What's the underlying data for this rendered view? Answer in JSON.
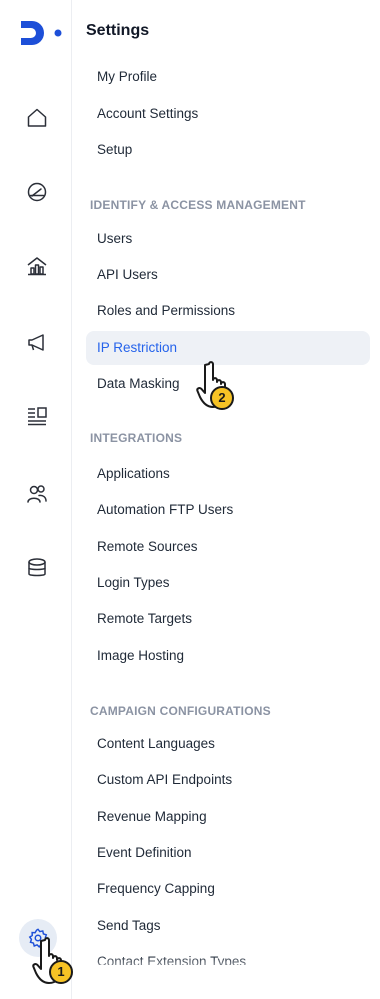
{
  "menu_title": "Settings",
  "top_items": [
    "My Profile",
    "Account Settings",
    "Setup"
  ],
  "sections": [
    {
      "title": "IDENTIFY & ACCESS MANAGEMENT",
      "items": [
        "Users",
        "API Users",
        "Roles and Permissions",
        "IP Restriction",
        "Data Masking"
      ]
    },
    {
      "title": "INTEGRATIONS",
      "items": [
        "Applications",
        "Automation FTP Users",
        "Remote Sources",
        "Login Types",
        "Remote Targets",
        "Image Hosting"
      ]
    },
    {
      "title": "CAMPAIGN CONFIGURATIONS",
      "items": [
        "Content Languages",
        "Custom API Endpoints",
        "Revenue Mapping",
        "Event Definition",
        "Frequency Capping",
        "Send Tags",
        "Contact Extension Types"
      ]
    }
  ],
  "active_item": "IP Restriction",
  "rail_icons": [
    "home-icon",
    "dashboard-gauge-icon",
    "analytics-icon",
    "campaign-megaphone-icon",
    "content-list-icon",
    "audience-users-icon",
    "database-icon",
    "settings-gear-icon"
  ],
  "step_badges": {
    "first": "1",
    "second": "2"
  },
  "colors": {
    "brand": "#1d4fd8",
    "active_text": "#2563eb",
    "active_bg": "#eef1f6",
    "badge": "#f7c325",
    "section": "#8b93a3"
  }
}
